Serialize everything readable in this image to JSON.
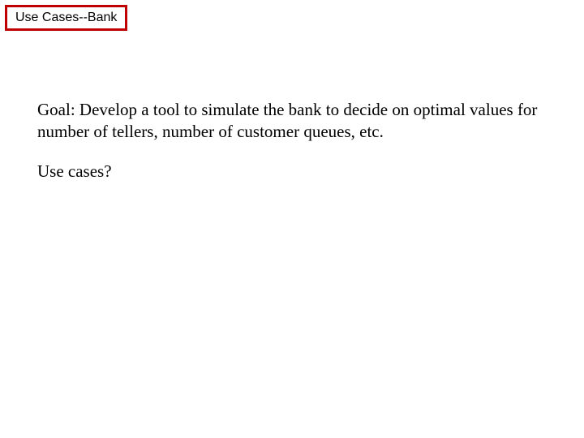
{
  "title": "Use Cases--Bank",
  "goal": "Goal:  Develop a tool to simulate the bank to decide on optimal values for number of tellers, number of customer queues, etc.",
  "question": "Use cases?"
}
